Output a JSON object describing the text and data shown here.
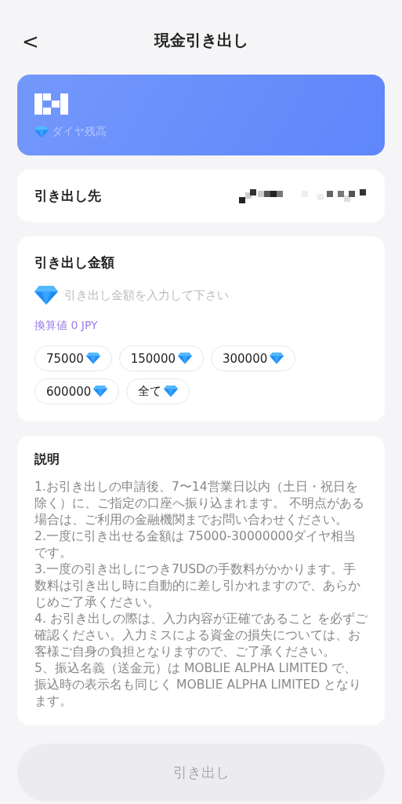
{
  "header": {
    "back": "<",
    "title": "現金引き出し"
  },
  "balance": {
    "label": "ダイヤ残高"
  },
  "destination": {
    "label": "引き出し先"
  },
  "amount": {
    "title": "引き出し金額",
    "placeholder": "引き出し金額を入力して下さい",
    "conversion": "換算値 0 JPY",
    "presets": [
      {
        "label": "75000",
        "selected": false
      },
      {
        "label": "150000",
        "selected": false
      },
      {
        "label": "300000",
        "selected": false
      },
      {
        "label": "600000",
        "selected": false
      },
      {
        "label": "全て",
        "selected": false
      }
    ]
  },
  "notes": {
    "title": "説明",
    "items": [
      "1.お引き出しの申請後、7〜14営業日以内（土日・祝日を除く）に、ご指定の口座へ振り込まれます。 不明点がある場合は、ご利用の金融機関までお問い合わせください。",
      "2.一度に引き出せる金額は 75000-30000000ダイヤ相当です。",
      "3.一度の引き出しにつき7USDの手数料がかかります。手数料は引き出し時に自動的に差し引かれますので、あらかじめご了承ください。",
      "4. お引き出しの際は、入力内容が正確であること を必ずご確認ください。入力ミスによる資金の損失については、お客様ご自身の負担となりますので、ご了承ください。",
      "5、振込名義（送金元）は MOBLIE ALPHA LIMITED で、振込時の表示名も同じく MOBLIE ALPHA LIMITED となります。"
    ]
  },
  "submit": {
    "label": "引き出し",
    "disabled": true
  }
}
